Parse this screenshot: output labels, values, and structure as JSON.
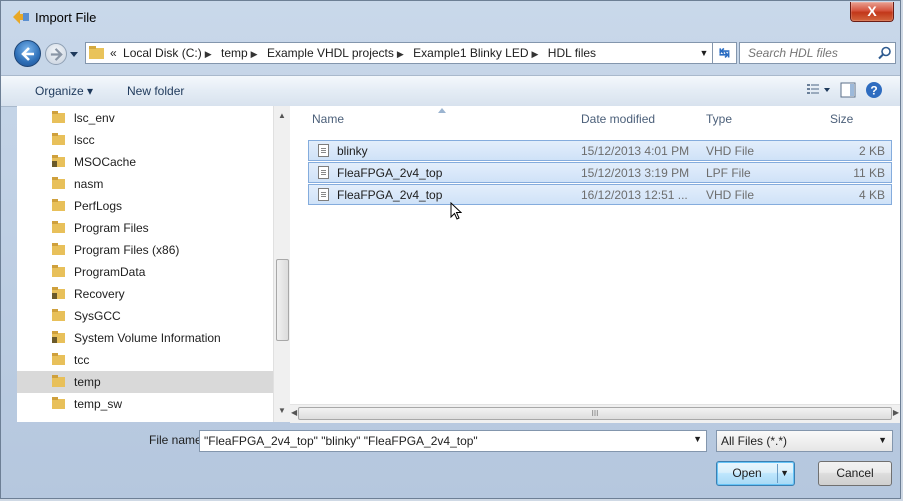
{
  "window": {
    "title": "Import File",
    "close_label": "X"
  },
  "address": {
    "crumbs": [
      "«",
      "Local Disk (C:)",
      "temp",
      "Example VHDL projects",
      "Example1 Blinky LED",
      "HDL files"
    ],
    "search_placeholder": "Search HDL files"
  },
  "toolbar": {
    "organize": "Organize ▾",
    "new_folder": "New folder"
  },
  "nav": {
    "items": [
      {
        "label": "lsc_env",
        "icon": "folder-icon"
      },
      {
        "label": "lscc",
        "icon": "folder-icon"
      },
      {
        "label": "MSOCache",
        "icon": "locked-folder-icon"
      },
      {
        "label": "nasm",
        "icon": "folder-icon"
      },
      {
        "label": "PerfLogs",
        "icon": "folder-icon"
      },
      {
        "label": "Program Files",
        "icon": "folder-icon"
      },
      {
        "label": "Program Files (x86)",
        "icon": "folder-icon"
      },
      {
        "label": "ProgramData",
        "icon": "folder-icon"
      },
      {
        "label": "Recovery",
        "icon": "locked-folder-icon"
      },
      {
        "label": "SysGCC",
        "icon": "folder-icon"
      },
      {
        "label": "System Volume Information",
        "icon": "locked-folder-icon"
      },
      {
        "label": "tcc",
        "icon": "folder-icon"
      },
      {
        "label": "temp",
        "icon": "folder-icon",
        "selected": true
      },
      {
        "label": "temp_sw",
        "icon": "folder-icon"
      }
    ]
  },
  "files": {
    "columns": [
      "Name",
      "Date modified",
      "Type",
      "Size"
    ],
    "rows": [
      {
        "name": "blinky",
        "date": "15/12/2013 4:01 PM",
        "type": "VHD File",
        "size": "2 KB"
      },
      {
        "name": "FleaFPGA_2v4_top",
        "date": "15/12/2013 3:19 PM",
        "type": "LPF File",
        "size": "11 KB"
      },
      {
        "name": "FleaFPGA_2v4_top",
        "date": "16/12/2013 12:51 ...",
        "type": "VHD File",
        "size": "4 KB"
      }
    ],
    "hscroll_grip": "III"
  },
  "bottom": {
    "file_name_label": "File name:",
    "file_name_value": "\"FleaFPGA_2v4_top\" \"blinky\" \"FleaFPGA_2v4_top\"",
    "filter_value": "All Files (*.*)",
    "open_label": "Open",
    "cancel_label": "Cancel"
  }
}
